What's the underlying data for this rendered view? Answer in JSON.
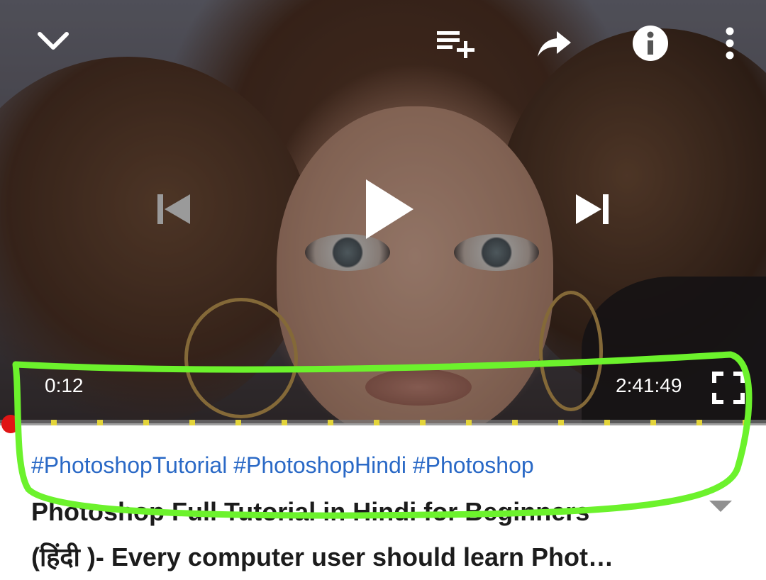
{
  "player": {
    "current_time": "0:12",
    "duration": "2:41:49",
    "progress": 0.0012,
    "chapter_marks": 16
  },
  "top_controls": {
    "collapse_icon": "chevron-down-icon",
    "add_to_queue_icon": "playlist-add-icon",
    "share_icon": "share-icon",
    "info_icon": "info-icon",
    "more_icon": "more-vert-icon"
  },
  "center_controls": {
    "previous_icon": "skip-previous-icon",
    "play_icon": "play-icon",
    "next_icon": "skip-next-icon"
  },
  "video": {
    "hashtags": "#PhotoshopTutorial #PhotoshopHindi #Photoshop",
    "title_line1": "Photoshop Full Tutorial in Hindi for Beginners",
    "title_line2": "(हिंदी )- Every computer user should learn Phot…"
  },
  "colors": {
    "accent_red": "#e01515",
    "hashtag_blue": "#2a69c6",
    "chapter_yellow": "#e3d43a",
    "annotation_green": "#6cf22c"
  }
}
